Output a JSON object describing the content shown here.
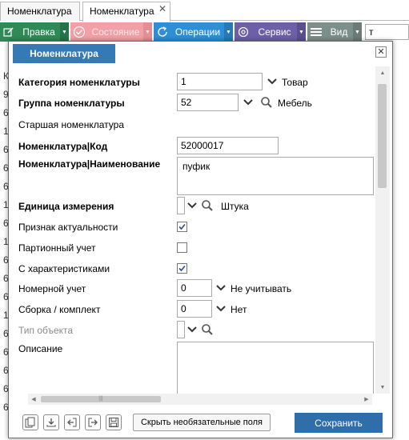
{
  "tabs": [
    {
      "label": "Номенклатура"
    },
    {
      "label": "Номенклатура",
      "close": "✕"
    }
  ],
  "toolbar": {
    "edit": "Правка",
    "state": "Состояние",
    "operations": "Операции",
    "service": "Сервис",
    "view": "Вид",
    "search_value": "т"
  },
  "background_rows": [
    "К",
    "9",
    "6",
    "1",
    "6",
    "6",
    "6",
    "1",
    "6",
    "1",
    "6",
    "6",
    "6",
    "1",
    "6",
    "6",
    "6",
    "6",
    "6"
  ],
  "modal": {
    "title": "Номенклатура",
    "close": "✕",
    "fields": {
      "category_label": "Категория номенклатуры",
      "category_value": "1",
      "category_name": "Товар",
      "group_label": "Группа номенклатуры",
      "group_value": "52",
      "group_name": "Мебель",
      "parent_label": "Старшая номенклатура",
      "code_label": "Номенклатура|Код",
      "code_value": "52000017",
      "name_label": "Номенклатура|Наименование",
      "name_value": "пуфик",
      "unit_label": "Единица измерения",
      "unit_value": "",
      "unit_name": "Штука",
      "actual_label": "Признак актуальности",
      "actual_checked": true,
      "batch_label": "Партионный учет",
      "batch_checked": false,
      "chars_label": "С характеристиками",
      "chars_checked": true,
      "numbered_label": "Номерной учет",
      "numbered_value": "0",
      "numbered_name": "Не учитывать",
      "assembly_label": "Сборка / комплект",
      "assembly_value": "0",
      "assembly_name": "Нет",
      "objtype_label": "Тип объекта",
      "objtype_value": "",
      "description_label": "Описание",
      "description_value": ""
    },
    "footer": {
      "hide_optional": "Скрыть необязательные поля",
      "save": "Сохранить"
    }
  }
}
